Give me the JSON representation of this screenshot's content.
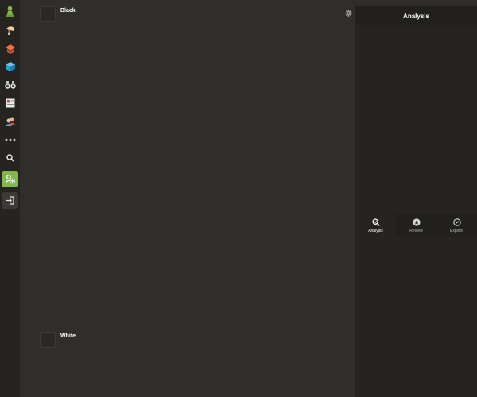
{
  "board": {
    "top_player": "Black",
    "bottom_player": "White"
  },
  "panel": {
    "title": "Analysis",
    "tabs": [
      {
        "label": "Analysis",
        "icon": "magnifier-analysis-icon",
        "active": true
      },
      {
        "label": "Review",
        "icon": "star-review-icon",
        "active": false
      },
      {
        "label": "Explore",
        "icon": "compass-explore-icon",
        "active": false
      }
    ]
  },
  "nav": {
    "items": [
      "play-pawn-icon",
      "puzzles-icon",
      "lessons-icon",
      "learn-cube-icon",
      "watch-binoculars-icon",
      "news-icon",
      "social-icon",
      "more-icon",
      "search-icon",
      "add-friend-icon",
      "login-icon"
    ],
    "colors": {
      "green": "#81b64c",
      "orange": "#f36f3f",
      "blue": "#2aa2d6"
    }
  }
}
